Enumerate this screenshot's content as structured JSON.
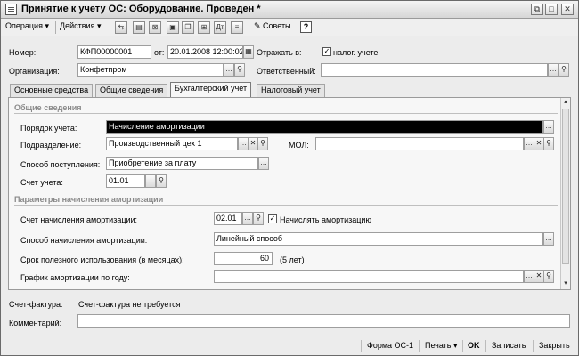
{
  "window": {
    "title": "Принятие к учету ОС: Оборудование. Проведен *"
  },
  "toolbar": {
    "operation": "Операция",
    "actions": "Действия",
    "advice": "Советы",
    "help": "?"
  },
  "header": {
    "number_label": "Номер:",
    "number_value": "КФП00000001",
    "from_label": "от:",
    "date_value": "20.01.2008 12:00:02",
    "reflect_label": "Отражать в:",
    "tax_checkbox_label": "налог. учете",
    "tax_checked": true,
    "org_label": "Организация:",
    "org_value": "Конфетпром",
    "responsible_label": "Ответственный:",
    "responsible_value": ""
  },
  "tabs": [
    {
      "label": "Основные средства",
      "active": false
    },
    {
      "label": "Общие сведения",
      "active": false
    },
    {
      "label": "Бухгалтерский учет",
      "active": true
    },
    {
      "label": "Налоговый учет",
      "active": false
    }
  ],
  "general": {
    "section_title": "Общие сведения",
    "order_label": "Порядок учета:",
    "order_value": "Начисление амортизации",
    "division_label": "Подразделение:",
    "division_value": "Производственный цех 1",
    "mol_label": "МОЛ:",
    "mol_value": "",
    "receipt_label": "Способ поступления:",
    "receipt_value": "Приобретение за плату",
    "account_label": "Счет учета:",
    "account_value": "01.01"
  },
  "depreciation": {
    "section_title": "Параметры начисления амортизации",
    "account_label": "Счет начисления амортизации:",
    "account_value": "02.01",
    "accrue_label": "Начислять амортизацию",
    "accrue_checked": true,
    "method_label": "Способ начисления амортизации:",
    "method_value": "Линейный способ",
    "term_label": "Срок полезного использования (в месяцах):",
    "term_value": "60",
    "term_years": "(5 лет)",
    "schedule_label": "График амортизации по году:",
    "schedule_value": ""
  },
  "footer": {
    "invoice_label": "Счет-фактура:",
    "invoice_value": "Счет-фактура не требуется",
    "comment_label": "Комментарий:",
    "comment_value": ""
  },
  "bottom": {
    "form": "Форма ОС-1",
    "print": "Печать",
    "ok": "OK",
    "save": "Записать",
    "close": "Закрыть"
  }
}
